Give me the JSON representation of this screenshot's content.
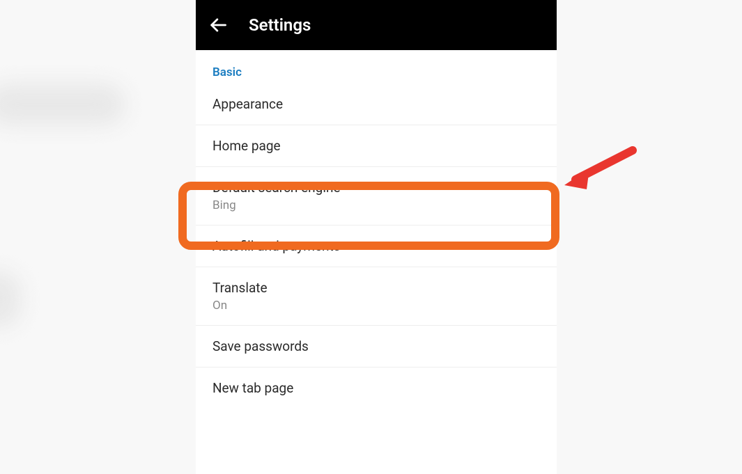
{
  "header": {
    "title": "Settings"
  },
  "section": {
    "label": "Basic"
  },
  "items": {
    "appearance": {
      "title": "Appearance"
    },
    "homepage": {
      "title": "Home page"
    },
    "search_engine": {
      "title": "Default search engine",
      "sub": "Bing"
    },
    "autofill": {
      "title": "Autofill and payments"
    },
    "translate": {
      "title": "Translate",
      "sub": "On"
    },
    "passwords": {
      "title": "Save passwords"
    },
    "newtab": {
      "title": "New tab page"
    }
  }
}
